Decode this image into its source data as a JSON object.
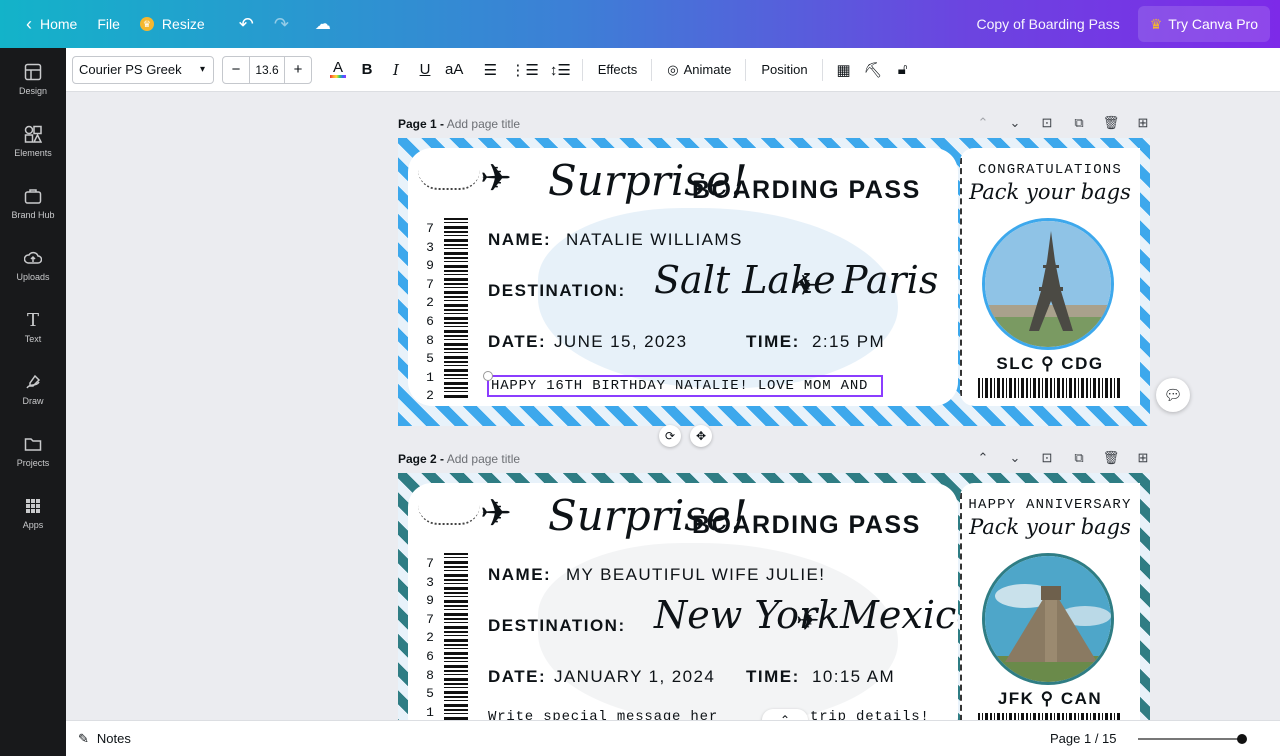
{
  "topbar": {
    "home": "Home",
    "file": "File",
    "resize": "Resize",
    "doc_title": "Copy of Boarding Pass",
    "try_pro": "Try Canva Pro"
  },
  "rail": [
    {
      "label": "Design",
      "icon": "design-icon"
    },
    {
      "label": "Elements",
      "icon": "elements-icon"
    },
    {
      "label": "Brand Hub",
      "icon": "brand-hub-icon"
    },
    {
      "label": "Uploads",
      "icon": "uploads-icon"
    },
    {
      "label": "Text",
      "icon": "text-icon"
    },
    {
      "label": "Draw",
      "icon": "draw-icon"
    },
    {
      "label": "Projects",
      "icon": "projects-icon"
    },
    {
      "label": "Apps",
      "icon": "apps-icon"
    }
  ],
  "toolbar": {
    "font": "Courier PS Greek",
    "size": "13.6",
    "minus": "−",
    "plus": "+",
    "effects": "Effects",
    "animate": "Animate",
    "position": "Position"
  },
  "pages": [
    {
      "num": "Page 1 -",
      "add_title": "Add page title",
      "theme": "blue",
      "surprise": "Surprise!",
      "title": "BOARDING PASS",
      "name_label": "NAME:",
      "name_value": "NATALIE WILLIAMS",
      "dest_label": "DESTINATION:",
      "from_city": "Salt Lake",
      "to_city": "Paris",
      "date_label": "DATE:",
      "date_value": "JUNE 15, 2023",
      "time_label": "TIME:",
      "time_value": "2:15 PM",
      "message": "HAPPY 16TH BIRTHDAY NATALIE! LOVE MOM AND",
      "stub_heading": "CONGRATULATIONS",
      "stub_script": "Pack your bags",
      "codes": "SLC ⚲ CDG",
      "barcode_digits": [
        "7",
        "3",
        "9",
        "7",
        "2",
        "6",
        "8",
        "5",
        "1",
        "2"
      ]
    },
    {
      "num": "Page 2 -",
      "add_title": "Add page title",
      "theme": "teal",
      "surprise": "Surprise!",
      "title": "BOARDING PASS",
      "name_label": "NAME:",
      "name_value": "MY BEAUTIFUL WIFE JULIE!",
      "dest_label": "DESTINATION:",
      "from_city": "New York",
      "to_city": "Mexico",
      "date_label": "DATE:",
      "date_value": "JANUARY 1, 2024",
      "time_label": "TIME:",
      "time_value": "10:15 AM",
      "message": "Write special message her",
      "message_tail": "trip details!",
      "stub_heading": "HAPPY ANNIVERSARY",
      "stub_script": "Pack your bags",
      "codes": "JFK ⚲ CAN",
      "barcode_digits": [
        "7",
        "3",
        "9",
        "7",
        "2",
        "6",
        "8",
        "5",
        "1"
      ]
    }
  ],
  "bottombar": {
    "notes": "Notes",
    "page_indicator": "Page 1 / 15",
    "zoom_level": 0.98
  },
  "colors": {
    "blue_stripe": "#3da8ec",
    "teal_stripe": "#2f7d84",
    "selection": "#8b3dff"
  }
}
